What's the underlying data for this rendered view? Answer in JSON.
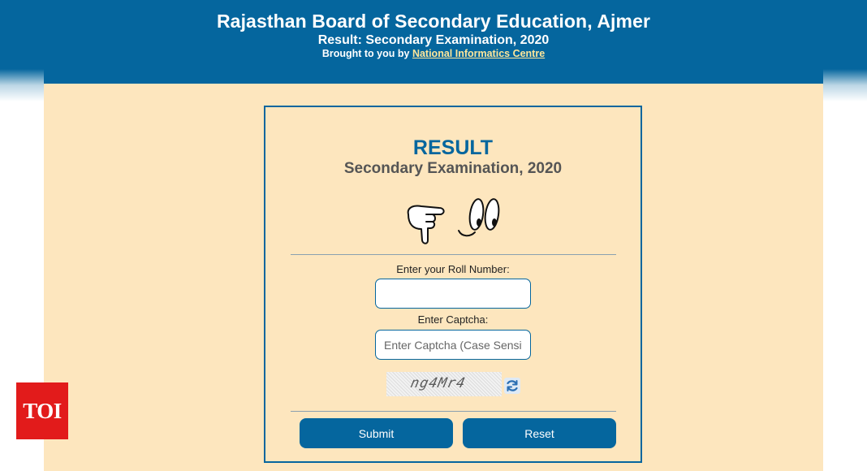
{
  "header": {
    "title": "Rajasthan Board of Secondary Education, Ajmer",
    "subtitle": "Result: Secondary Examination, 2020",
    "credit_prefix": "Brought to you by",
    "credit_link": "National Informatics Centre"
  },
  "card": {
    "heading": "RESULT",
    "subheading": "Secondary Examination, 2020",
    "illustration_icon": "pointing-hand-and-eyes-icon"
  },
  "form": {
    "roll_label": "Enter your Roll Number:",
    "roll_value": "",
    "captcha_label": "Enter Captcha:",
    "captcha_placeholder": "Enter Captcha (Case Sensitive)",
    "captcha_text": "ng4Mr4",
    "refresh_icon": "refresh-icon",
    "submit_label": "Submit",
    "reset_label": "Reset"
  },
  "watermark": {
    "logo_text": "TOI"
  },
  "colors": {
    "primary": "#05669e",
    "background": "#fde6be",
    "link": "#ffe69a",
    "watermark": "#e21b1b"
  }
}
